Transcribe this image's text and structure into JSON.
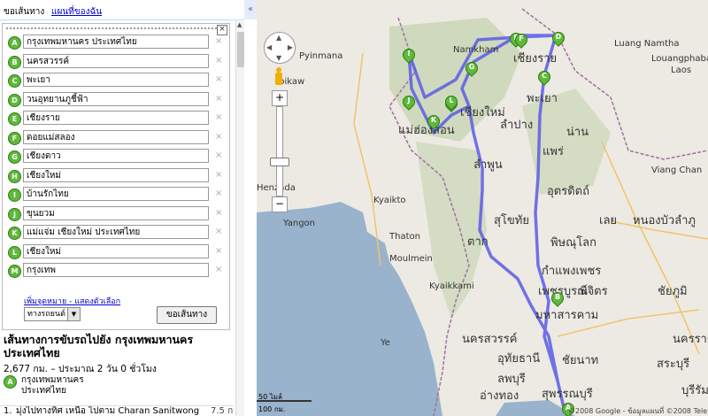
{
  "tabs": {
    "directions": "ขอเส้นทาง",
    "my_maps": "แผนที่ของฉัน"
  },
  "collapse_glyph": "«",
  "waypoints": [
    {
      "letter": "A",
      "value": "กรุงเทพมหานคร ประเทศไทย"
    },
    {
      "letter": "B",
      "value": "นครสวรรค์"
    },
    {
      "letter": "C",
      "value": "พะเยา"
    },
    {
      "letter": "D",
      "value": "วนอุทยานภูชี้ฟ้า"
    },
    {
      "letter": "E",
      "value": "เชียงราย"
    },
    {
      "letter": "F",
      "value": "ดอยแม่สลอง"
    },
    {
      "letter": "G",
      "value": "เชียงดาว"
    },
    {
      "letter": "H",
      "value": "เชียงใหม่"
    },
    {
      "letter": "I",
      "value": "บ้านรักไทย"
    },
    {
      "letter": "J",
      "value": "ขุนยวม"
    },
    {
      "letter": "K",
      "value": "แม่แจ่ม เชียงใหม่ ประเทศไทย"
    },
    {
      "letter": "L",
      "value": "เชียงใหม่"
    },
    {
      "letter": "M",
      "value": "กรุงเทพ"
    }
  ],
  "remove_glyph": "×",
  "links_text": "เพิ่มจุดหมาย - แสดงตัวเลือก",
  "travel_mode": "ทางรถยนต์",
  "get_directions_button": "ขอเส้นทาง",
  "summary": {
    "title": "เส้นทางการขับรถไปยัง กรุงเทพมหานคร ประเทศไทย",
    "distance": "2,677 กม. – ประมาณ 2 วัน 0 ชั่วโมง",
    "start_letter": "A",
    "start_name": "กรุงเทพมหานคร ประเทศไทย"
  },
  "first_step": {
    "num": "1.",
    "text": "มุ่งไปทางทิศ เหนือ ไปตาม Charan Sanitwong",
    "dist": "7.5 กม."
  },
  "map": {
    "zoom_plus": "+",
    "zoom_minus": "−",
    "scale_imperial": "50 ไมล์",
    "scale_metric": "100 กม.",
    "copyright": "©2008 Google - ข้อมูลแผนที่ ©2008 Tele Atlas",
    "logo": "Google",
    "route_color": "#5a5ce6",
    "water_color": "#99b3cc",
    "labels": [
      {
        "text": "Pyinmana",
        "size": "sm"
      },
      {
        "text": "Namkham",
        "size": "sm"
      },
      {
        "text": "Luang Namtha",
        "size": "sm"
      },
      {
        "text": "Louangphabang",
        "size": "sm"
      },
      {
        "text": "Laos",
        "size": "sm"
      },
      {
        "text": "Loikaw",
        "size": "sm"
      },
      {
        "text": "Viang Chan",
        "size": "sm"
      },
      {
        "text": "Yangon",
        "size": "sm"
      },
      {
        "text": "Moulmein",
        "size": "sm"
      },
      {
        "text": "Kyaikto",
        "size": "sm"
      },
      {
        "text": "Thaton",
        "size": "sm"
      },
      {
        "text": "Henzada",
        "size": "sm"
      },
      {
        "text": "Kyaikkami",
        "size": "sm"
      },
      {
        "text": "Ye",
        "size": "sm"
      },
      {
        "text": "แม่ฮ่องสอน",
        "size": "lg"
      },
      {
        "text": "เชียงใหม่",
        "size": "lg"
      },
      {
        "text": "เชียงราย",
        "size": "lg"
      },
      {
        "text": "พะเยา",
        "size": "lg"
      },
      {
        "text": "ลำปาง",
        "size": "lg"
      },
      {
        "text": "น่าน",
        "size": "lg"
      },
      {
        "text": "ลำพูน",
        "size": "lg"
      },
      {
        "text": "แพร่",
        "size": "lg"
      },
      {
        "text": "อุตรดิตถ์",
        "size": "lg"
      },
      {
        "text": "เลย",
        "size": "lg"
      },
      {
        "text": "หนองบัวลำภู",
        "size": "lg"
      },
      {
        "text": "สุโขทัย",
        "size": "lg"
      },
      {
        "text": "ตาก",
        "size": "lg"
      },
      {
        "text": "พิษณุโลก",
        "size": "lg"
      },
      {
        "text": "กำแพงเพชร",
        "size": "lg"
      },
      {
        "text": "เพชรบูรณ์",
        "size": "lg"
      },
      {
        "text": "พิจิตร",
        "size": "lg"
      },
      {
        "text": "ชัยภูมิ",
        "size": "lg"
      },
      {
        "text": "มหาสารคาม",
        "size": "lg"
      },
      {
        "text": "นครสวรรค์",
        "size": "lg"
      },
      {
        "text": "อุทัยธานี",
        "size": "lg"
      },
      {
        "text": "ชัยนาท",
        "size": "lg"
      },
      {
        "text": "ลพบุรี",
        "size": "lg"
      },
      {
        "text": "อ่างทอง",
        "size": "lg"
      },
      {
        "text": "สุพรรณบุรี",
        "size": "lg"
      },
      {
        "text": "สระบุรี",
        "size": "lg"
      },
      {
        "text": "นครราชสีมา",
        "size": "lg"
      },
      {
        "text": "บุรีรัมย์",
        "size": "lg"
      }
    ],
    "pins": [
      "A",
      "B",
      "C",
      "D",
      "E",
      "F",
      "G",
      "H",
      "I",
      "J",
      "K",
      "L"
    ]
  }
}
